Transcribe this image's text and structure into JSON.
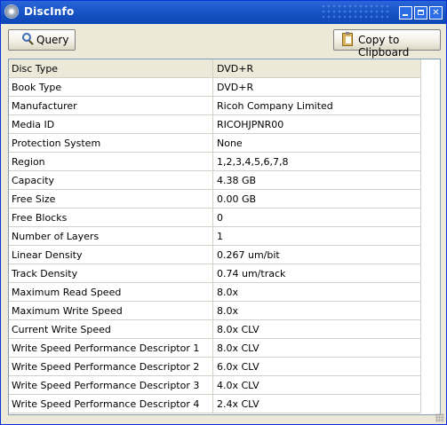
{
  "window": {
    "title": "DiscInfo"
  },
  "toolbar": {
    "query_label": "Query",
    "copy_label": "Copy to Clipboard"
  },
  "properties": [
    {
      "name": "Disc Type",
      "value": "DVD+R"
    },
    {
      "name": "Book Type",
      "value": "DVD+R"
    },
    {
      "name": "Manufacturer",
      "value": "Ricoh Company Limited"
    },
    {
      "name": "Media ID",
      "value": "RICOHJPNR00"
    },
    {
      "name": "Protection System",
      "value": "None"
    },
    {
      "name": "Region",
      "value": "1,2,3,4,5,6,7,8"
    },
    {
      "name": "Capacity",
      "value": "4.38 GB"
    },
    {
      "name": "Free Size",
      "value": "0.00 GB"
    },
    {
      "name": "Free Blocks",
      "value": "0"
    },
    {
      "name": "Number of Layers",
      "value": "1"
    },
    {
      "name": "Linear Density",
      "value": "0.267 um/bit"
    },
    {
      "name": "Track Density",
      "value": "0.74 um/track"
    },
    {
      "name": "Maximum Read Speed",
      "value": "8.0x"
    },
    {
      "name": "Maximum Write Speed",
      "value": "8.0x"
    },
    {
      "name": "Current Write Speed",
      "value": "8.0x CLV"
    },
    {
      "name": "Write Speed Performance Descriptor 1",
      "value": "8.0x CLV"
    },
    {
      "name": "Write Speed Performance Descriptor 2",
      "value": "6.0x CLV"
    },
    {
      "name": "Write Speed Performance Descriptor 3",
      "value": "4.0x CLV"
    },
    {
      "name": "Write Speed Performance Descriptor 4",
      "value": "2.4x CLV"
    }
  ]
}
